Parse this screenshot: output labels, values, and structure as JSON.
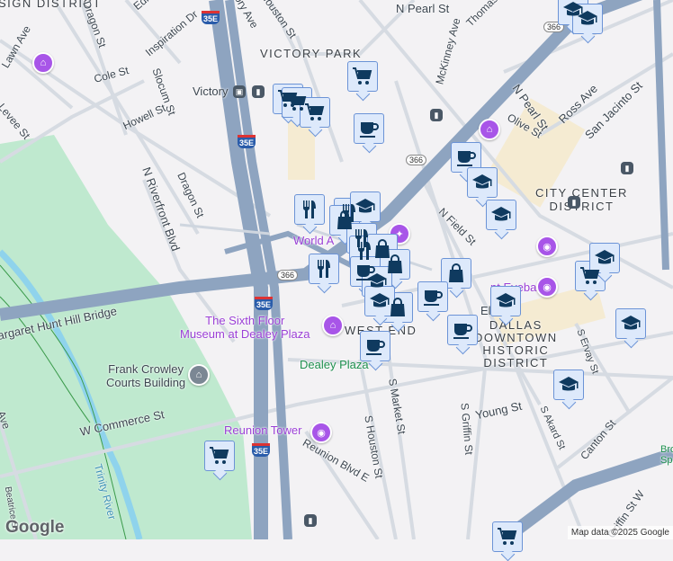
{
  "districts": {
    "design": "SIGN DISTRICT",
    "victory_park": "VICTORY PARK",
    "city_center": "CITY CENTER\nDISTRICT",
    "west_end": "WEST END",
    "downtown": "DALLAS\nDOWNTOWN\nHISTORIC\nDISTRICT"
  },
  "streets": {
    "dragon1": "Dragon St",
    "dragon2": "Dragon St",
    "inspiration": "Inspiration Dr",
    "cole": "Cole St",
    "slocum": "Slocum St",
    "howell": "Howell St",
    "lawn": "Lawn Ave",
    "levee": "Levee St",
    "houston_n": "Houston St",
    "victory_ave": "ory Ave",
    "pearl1": "N Pearl St",
    "pearl2": "N Pearl St",
    "thomas": "Thomas",
    "mckinney": "McKinney Ave",
    "ross": "Ross Ave",
    "san_jacinto": "San Jacinto St",
    "olive": "Olive St",
    "field": "N Field St",
    "elm": "Elm St",
    "riverfront": "N Riverfront Blvd",
    "hunt_bridge": "argaret Hunt Hill Bridge",
    "commerce": "W Commerce St",
    "market": "S Market St",
    "houston_s": "S Houston St",
    "griffin": "S Griffin St",
    "young": "Young St",
    "akard": "S Akard St",
    "ervay": "S Ervay St",
    "canton": "Canton St",
    "reunion": "Reunion Blvd E",
    "griffin_w": "Griffin St W",
    "beatrice": "Beatrice St",
    "edi": "Edi",
    "ave": "Ave"
  },
  "places": {
    "victory": "Victory",
    "world": "World A",
    "sixth_floor": "The Sixth Floor\nMuseum at Dealey Plaza",
    "crowley": "Frank Crowley\nCourts Building",
    "dealey": "Dealey Plaza",
    "reunion_tower": "Reunion Tower",
    "eyeball": "nt Eyeball",
    "trinity": "Trinity River",
    "bro": "Bro\nSp"
  },
  "shields": {
    "i35e": "35E",
    "r366": "366"
  },
  "markers": [
    "school",
    "school",
    "cart",
    "cart",
    "cart",
    "cart",
    "coffee",
    "coffee",
    "school",
    "school",
    "restaurant",
    "restaurant",
    "bag",
    "school",
    "restaurant",
    "restaurant",
    "bag",
    "restaurant",
    "bag",
    "bag",
    "coffee",
    "school",
    "cart",
    "coffee",
    "school",
    "coffee",
    "bag",
    "school",
    "school",
    "coffee",
    "school",
    "school",
    "cart",
    "cart"
  ],
  "branding": {
    "logo": "Google",
    "attribution": "Map data ©2025 Google"
  },
  "colors": {
    "marker_bg": "#dde9fb",
    "marker_icon": "#0f3a5f",
    "poi": "#a855e8"
  }
}
